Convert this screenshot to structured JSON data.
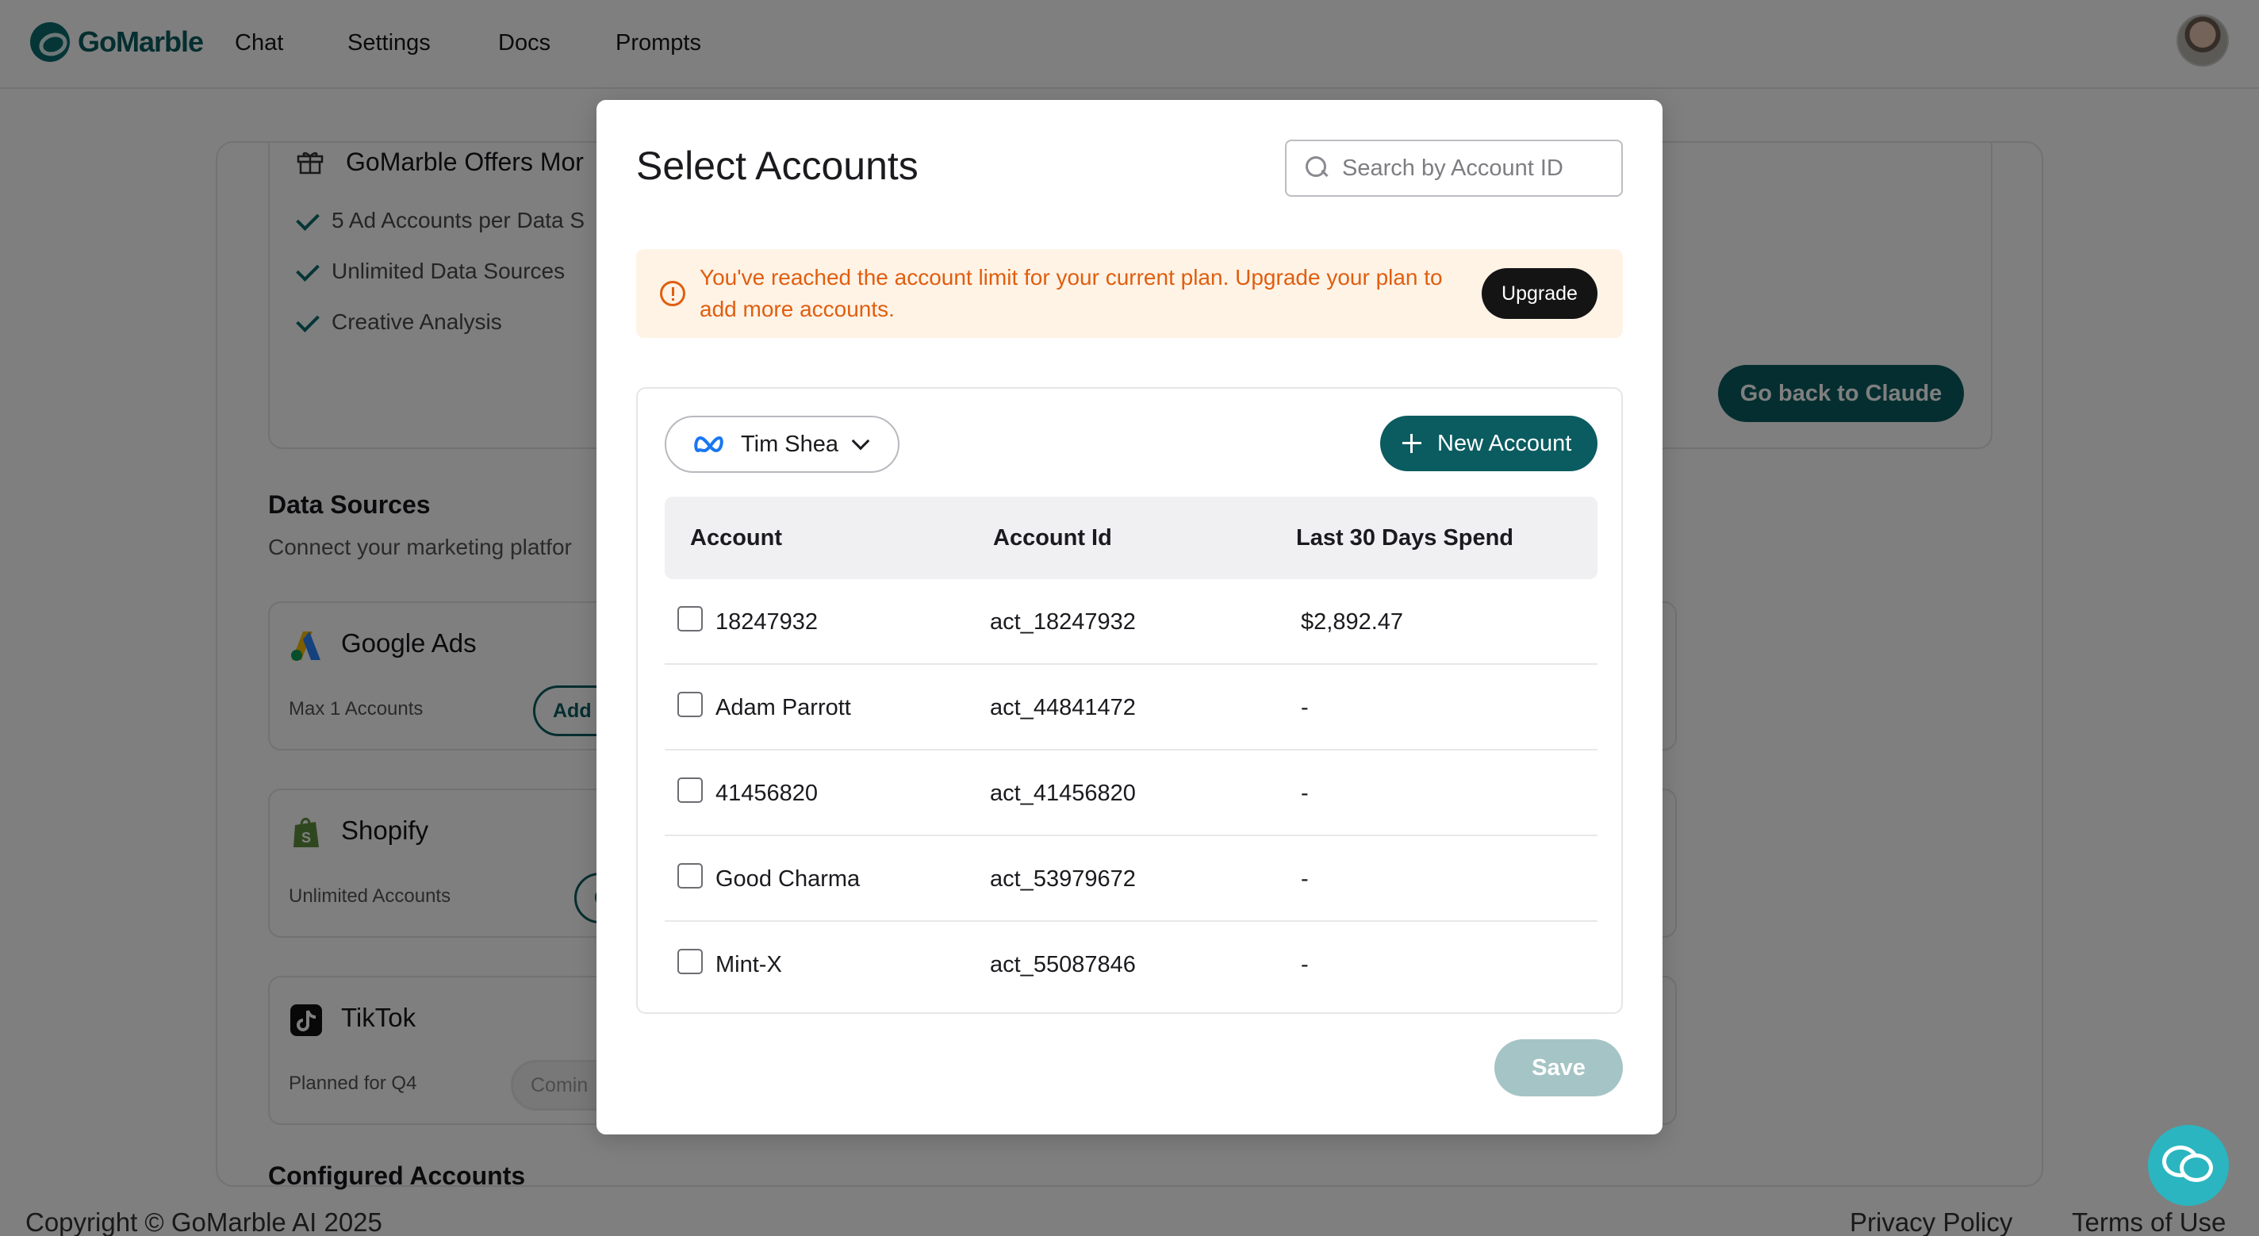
{
  "app": {
    "logo_text": "GoMarble",
    "nav": [
      "Chat",
      "Settings",
      "Docs",
      "Prompts"
    ]
  },
  "background": {
    "offer_title": "GoMarble Offers Mor",
    "offer_features": [
      "5 Ad Accounts per Data S",
      "Unlimited Data Sources",
      "Creative Analysis"
    ],
    "go_back_label": "Go back to Claude",
    "data_sources_title": "Data Sources",
    "data_sources_sub": "Connect your marketing platfor",
    "sources": [
      {
        "name": "Google Ads",
        "limit": "Max 1 Accounts",
        "button": "Add",
        "icon": "google-ads-icon"
      },
      {
        "name": "Shopify",
        "limit": "Unlimited Accounts",
        "button": "C",
        "icon": "shopify-icon"
      },
      {
        "name": "TikTok",
        "limit": "Planned for Q4",
        "button": "Comin",
        "icon": "tiktok-icon"
      }
    ],
    "configured_title": "Configured Accounts",
    "footer": {
      "copyright": "Copyright © GoMarble AI 2025",
      "privacy": "Privacy Policy",
      "terms": "Terms of Use"
    }
  },
  "modal": {
    "title": "Select Accounts",
    "search_placeholder": "Search by Account ID",
    "alert_text": "You've reached the account limit for your current plan. Upgrade your plan to add more accounts.",
    "upgrade_label": "Upgrade",
    "owner": "Tim Shea",
    "new_account_label": "New Account",
    "columns": [
      "Account",
      "Account Id",
      "Last 30 Days Spend"
    ],
    "rows": [
      {
        "name": "18247932",
        "id": "act_18247932",
        "spend": "$2,892.47",
        "checked": false
      },
      {
        "name": "Adam Parrott",
        "id": "act_44841472",
        "spend": "-",
        "checked": false
      },
      {
        "name": "41456820",
        "id": "act_41456820",
        "spend": "-",
        "checked": false
      },
      {
        "name": "Good Charma",
        "id": "act_53979672",
        "spend": "-",
        "checked": false
      },
      {
        "name": "Mint-X",
        "id": "act_55087846",
        "spend": "-",
        "checked": false
      }
    ],
    "save_label": "Save"
  },
  "colors": {
    "brand": "#0b5c60",
    "warning": "#e05e0f",
    "warning_bg": "#fff3e6",
    "save_disabled": "#a5c4c5",
    "chat_widget": "#2bb5c0"
  }
}
